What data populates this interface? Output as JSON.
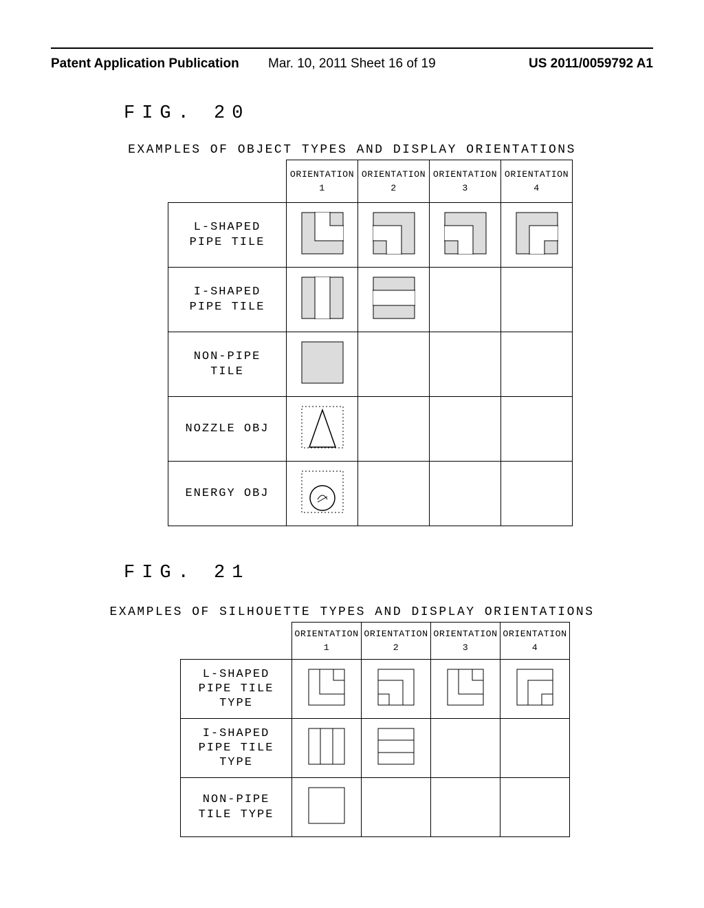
{
  "header": {
    "left": "Patent Application Publication",
    "middle": "Mar. 10, 2011  Sheet 16 of 19",
    "right": "US 2011/0059792 A1"
  },
  "fig20": {
    "label": "FIG. 20",
    "caption": "EXAMPLES OF OBJECT TYPES AND DISPLAY ORIENTATIONS",
    "col_headers": [
      "ORIENTATION\n1",
      "ORIENTATION\n2",
      "ORIENTATION\n3",
      "ORIENTATION\n4"
    ],
    "rows": [
      {
        "label": "L-SHAPED\nPIPE TILE",
        "cells": [
          "l1",
          "l2",
          "l3",
          "l4"
        ]
      },
      {
        "label": "I-SHAPED\nPIPE TILE",
        "cells": [
          "i1",
          "i2",
          "",
          ""
        ]
      },
      {
        "label": "NON-PIPE\nTILE",
        "cells": [
          "np",
          "",
          "",
          ""
        ]
      },
      {
        "label": "NOZZLE OBJ",
        "cells": [
          "noz",
          "",
          "",
          ""
        ]
      },
      {
        "label": "ENERGY OBJ",
        "cells": [
          "en",
          "",
          "",
          ""
        ]
      }
    ]
  },
  "fig21": {
    "label": "FIG. 21",
    "caption": "EXAMPLES OF SILHOUETTE TYPES AND DISPLAY ORIENTATIONS",
    "col_headers": [
      "ORIENTATION\n1",
      "ORIENTATION\n2",
      "ORIENTATION\n3",
      "ORIENTATION\n4"
    ],
    "rows": [
      {
        "label": "L-SHAPED\nPIPE TILE\nTYPE",
        "cells": [
          "sl1",
          "sl2",
          "sl3",
          "sl4"
        ]
      },
      {
        "label": "I-SHAPED\nPIPE TILE\nTYPE",
        "cells": [
          "si1",
          "si2",
          "",
          ""
        ]
      },
      {
        "label": "NON-PIPE\nTILE TYPE",
        "cells": [
          "snp",
          "",
          "",
          ""
        ]
      }
    ]
  }
}
